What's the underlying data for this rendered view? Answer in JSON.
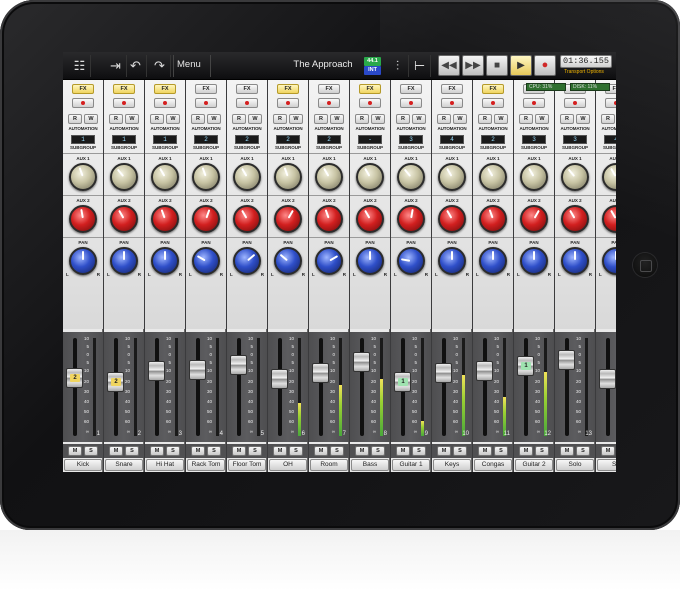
{
  "toolbar": {
    "menu_label": "Menu",
    "session_title": "The Approach",
    "sample_rate": "44.1",
    "clock_source": "INT",
    "time": "01:36.155",
    "transport_options": "Transport Options",
    "cpu_label": "CPU:",
    "cpu_value": "31%",
    "disk_label": "DISK:",
    "disk_value": "11%"
  },
  "labels": {
    "fx": "FX",
    "read": "R",
    "write": "W",
    "automation": "AUTOMATION",
    "subgroup": "SUBGROUP",
    "aux1": "AUX 1",
    "aux2": "AUX 2",
    "pan": "PAN",
    "left": "L",
    "right": "R",
    "mute": "M",
    "solo": "S"
  },
  "fader_scale": [
    "10",
    "5",
    "0",
    "5",
    "10",
    "20",
    "30",
    "40",
    "50",
    "60",
    "∞"
  ],
  "channels": [
    {
      "number": "1",
      "name": "Kick",
      "subgroup": "1",
      "fx_active": true,
      "fader_level": 0.62,
      "meter_level": 0,
      "badge": "2",
      "badge_color": "#f0d560"
    },
    {
      "number": "2",
      "name": "Snare",
      "subgroup": "1",
      "fx_active": true,
      "fader_level": 0.57,
      "meter_level": 0,
      "badge": "2",
      "badge_color": "#f0d560"
    },
    {
      "number": "3",
      "name": "Hi Hat",
      "subgroup": "1",
      "fx_active": true,
      "fader_level": 0.7,
      "meter_level": 0,
      "badge": "",
      "badge_color": ""
    },
    {
      "number": "4",
      "name": "Rack Tom",
      "subgroup": "2",
      "fx_active": false,
      "fader_level": 0.72,
      "meter_level": 0,
      "badge": "",
      "badge_color": ""
    },
    {
      "number": "5",
      "name": "Floor Tom",
      "subgroup": "2",
      "fx_active": false,
      "fader_level": 0.78,
      "meter_level": 0,
      "badge": "",
      "badge_color": ""
    },
    {
      "number": "6",
      "name": "OH",
      "subgroup": "2",
      "fx_active": true,
      "fader_level": 0.6,
      "meter_level": 0.34,
      "badge": "",
      "badge_color": ""
    },
    {
      "number": "7",
      "name": "Room",
      "subgroup": "2",
      "fx_active": false,
      "fader_level": 0.68,
      "meter_level": 0.52,
      "badge": "",
      "badge_color": ""
    },
    {
      "number": "8",
      "name": "Bass",
      "subgroup": "-",
      "fx_active": true,
      "fader_level": 0.82,
      "meter_level": 0.58,
      "badge": "",
      "badge_color": ""
    },
    {
      "number": "9",
      "name": "Guitar 1",
      "subgroup": "3",
      "fx_active": false,
      "fader_level": 0.56,
      "meter_level": 0.15,
      "badge": "1",
      "badge_color": "#9fe3b0"
    },
    {
      "number": "10",
      "name": "Keys",
      "subgroup": "4",
      "fx_active": false,
      "fader_level": 0.68,
      "meter_level": 0.62,
      "badge": "",
      "badge_color": ""
    },
    {
      "number": "11",
      "name": "Congas",
      "subgroup": "2",
      "fx_active": true,
      "fader_level": 0.7,
      "meter_level": 0.4,
      "badge": "",
      "badge_color": ""
    },
    {
      "number": "12",
      "name": "Guitar 2",
      "subgroup": "3",
      "fx_active": false,
      "fader_level": 0.77,
      "meter_level": 0.65,
      "badge": "1",
      "badge_color": "#9fe3b0"
    },
    {
      "number": "13",
      "name": "Solo",
      "subgroup": "3",
      "fx_active": false,
      "fader_level": 0.84,
      "meter_level": 0,
      "badge": "",
      "badge_color": ""
    },
    {
      "number": "14",
      "name": "Sh",
      "subgroup": "4",
      "fx_active": false,
      "fader_level": 0.6,
      "meter_level": 0,
      "badge": "",
      "badge_color": ""
    }
  ],
  "knob_rotations": [
    {
      "aux1": -20,
      "aux2": -10,
      "pan": 0
    },
    {
      "aux1": -40,
      "aux2": -30,
      "pan": 0
    },
    {
      "aux1": -30,
      "aux2": -20,
      "pan": 0
    },
    {
      "aux1": -20,
      "aux2": 20,
      "pan": -60
    },
    {
      "aux1": -30,
      "aux2": -30,
      "pan": 50
    },
    {
      "aux1": -20,
      "aux2": 30,
      "pan": -50
    },
    {
      "aux1": -30,
      "aux2": -20,
      "pan": 60
    },
    {
      "aux1": -30,
      "aux2": -30,
      "pan": 0
    },
    {
      "aux1": -40,
      "aux2": 10,
      "pan": -80
    },
    {
      "aux1": -30,
      "aux2": -30,
      "pan": 0
    },
    {
      "aux1": -30,
      "aux2": -20,
      "pan": 0
    },
    {
      "aux1": -30,
      "aux2": 30,
      "pan": 0
    },
    {
      "aux1": -40,
      "aux2": -30,
      "pan": 0
    },
    {
      "aux1": -30,
      "aux2": -30,
      "pan": 0
    }
  ]
}
